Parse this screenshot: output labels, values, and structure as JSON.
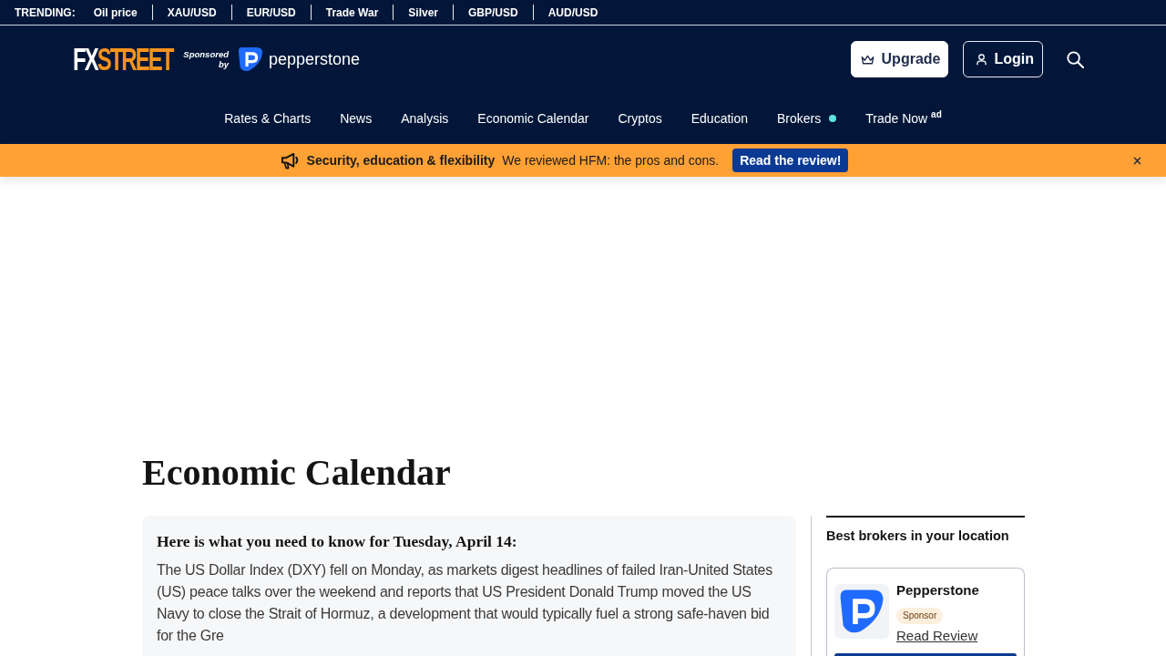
{
  "trending": {
    "label": "TRENDING:",
    "items": [
      "Oil price",
      "XAU/USD",
      "EUR/USD",
      "Trade War",
      "Silver",
      "GBP/USD",
      "AUD/USD"
    ]
  },
  "header": {
    "logo": {
      "lead": "FX",
      "rest": "STREET"
    },
    "sponsor_label": [
      "Sponsored",
      "by"
    ],
    "sponsor_name": "pepperstone",
    "buttons": [
      {
        "kind": "upgrade",
        "label": "Upgrade"
      },
      {
        "kind": "login",
        "label": "Login"
      }
    ]
  },
  "nav": [
    {
      "label": "Rates & Charts",
      "indicator": false
    },
    {
      "label": "News",
      "indicator": false
    },
    {
      "label": "Analysis",
      "indicator": false
    },
    {
      "label": "Economic Calendar",
      "indicator": false
    },
    {
      "label": "Cryptos",
      "indicator": false
    },
    {
      "label": "Education",
      "indicator": false
    },
    {
      "label": "Brokers",
      "indicator": true
    },
    {
      "label": "Trade Now $^{ad}$",
      "indicator": false
    }
  ],
  "promo_banner": {
    "title": "Security, education & flexibility",
    "text": "We reviewed HFM: the pros and cons.",
    "button": "Read the review!"
  },
  "page": {
    "title": "Economic Calendar"
  },
  "summary": {
    "heading": "Here is what you need to know for Tuesday, April 14:",
    "text": "The US Dollar Index (DXY) fell on Monday, as markets digest headlines of failed Iran-United States (US) peace talks over the weekend and reports that US President Donald Trump moved the US Navy to close the Strait of Hormuz, a development that would typically fuel a strong safe-haven bid for the Gre"
  },
  "sidebar": {
    "title": "Best brokers in your location",
    "brokers": [
      {
        "name": "Pepperstone",
        "badge": "Sponsor",
        "link": "Read Review"
      }
    ]
  }
}
